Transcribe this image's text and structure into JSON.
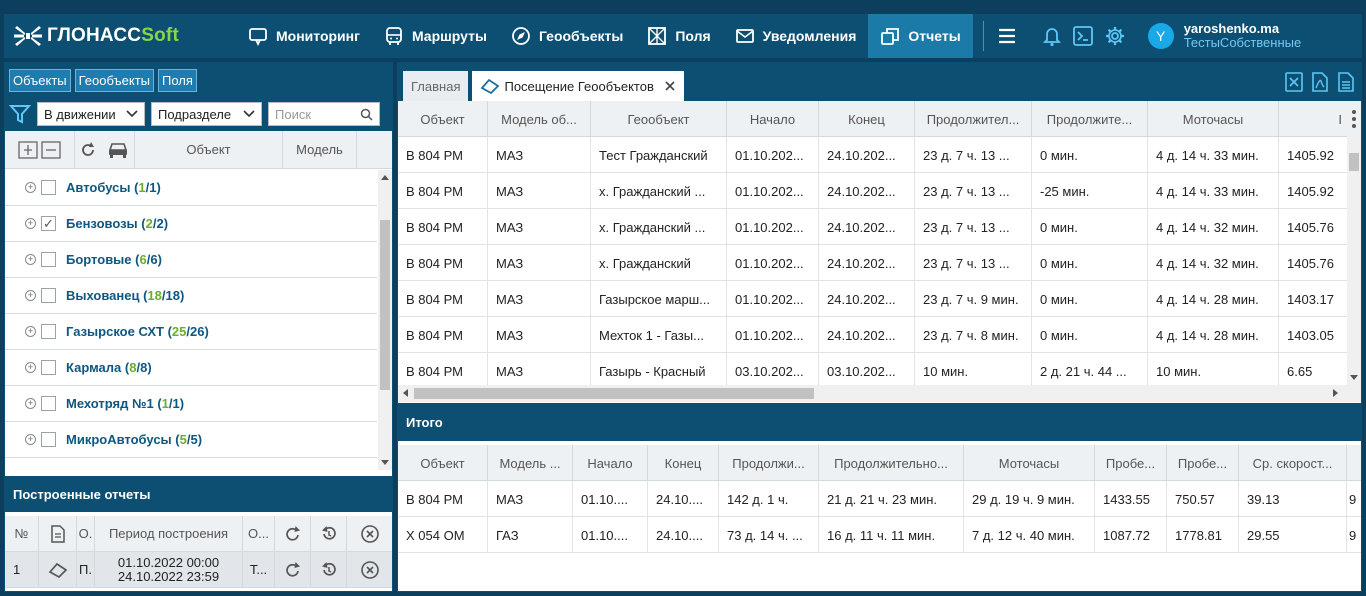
{
  "app": {
    "logo_main": "ГЛОНАСС",
    "logo_soft": "Soft"
  },
  "nav": [
    {
      "label": "Мониторинг",
      "icon": "monitor-icon"
    },
    {
      "label": "Маршруты",
      "icon": "bus-icon"
    },
    {
      "label": "Геообъекты",
      "icon": "compass-icon"
    },
    {
      "label": "Поля",
      "icon": "field-icon"
    },
    {
      "label": "Уведомления",
      "icon": "mail-icon"
    },
    {
      "label": "Отчеты",
      "icon": "reports-icon",
      "active": true
    }
  ],
  "user": {
    "initial": "Y",
    "name": "yaroshenko.ma",
    "org": "ТестыСобственные"
  },
  "left": {
    "tabs": [
      "Объекты",
      "Геообъекты",
      "Поля"
    ],
    "filter": {
      "motion": "В движении",
      "division": "Подразделе",
      "search_placeholder": "Поиск"
    },
    "columns": {
      "object": "Объект",
      "model": "Модель"
    },
    "groups": [
      {
        "name": "Автобусы",
        "on": "1",
        "total": "1",
        "checked": false
      },
      {
        "name": "Бензовозы",
        "on": "2",
        "total": "2",
        "checked": true
      },
      {
        "name": "Бортовые",
        "on": "6",
        "total": "6",
        "checked": false
      },
      {
        "name": "Выхованец",
        "on": "18",
        "total": "18",
        "checked": false
      },
      {
        "name": "Газырское СХТ",
        "on": "25",
        "total": "26",
        "checked": false
      },
      {
        "name": "Кармала",
        "on": "8",
        "total": "8",
        "checked": false
      },
      {
        "name": "Мехотряд №1",
        "on": "1",
        "total": "1",
        "checked": false
      },
      {
        "name": "МикроАвтобусы",
        "on": "5",
        "total": "5",
        "checked": false
      }
    ],
    "built_title": "Построенные отчеты",
    "built_cols": {
      "num": "№",
      "o1": "О.",
      "period": "Период построения",
      "o2": "О..."
    },
    "built_rows": [
      {
        "num": "1",
        "o1": "П.",
        "period_from": "01.10.2022 00:00",
        "period_to": "24.10.2022 23:59",
        "o2": "Т..."
      }
    ]
  },
  "right": {
    "tabs": {
      "home": "Главная",
      "report": "Посещение Геообъектов"
    },
    "grid_cols": [
      "Объект",
      "Модель об...",
      "Геообъект",
      "Начало",
      "Конец",
      "Продолжител...",
      "Продолжите...",
      "Моточасы",
      "I"
    ],
    "grid_rows": [
      [
        "В 804 РМ",
        "МАЗ",
        "Тест Гражданский",
        "01.10.202...",
        "24.10.202...",
        "23 д. 7 ч. 13 ...",
        "0 мин.",
        "4 д. 14 ч. 33 мин.",
        "1405.92"
      ],
      [
        "В 804 РМ",
        "МАЗ",
        "х. Гражданский ...",
        "01.10.202...",
        "24.10.202...",
        "23 д. 7 ч. 13 ...",
        "-25 мин.",
        "4 д. 14 ч. 33 мин.",
        "1405.92"
      ],
      [
        "В 804 РМ",
        "МАЗ",
        "х. Гражданский ...",
        "01.10.202...",
        "24.10.202...",
        "23 д. 7 ч. 13 ...",
        "0 мин.",
        "4 д. 14 ч. 32 мин.",
        "1405.76"
      ],
      [
        "В 804 РМ",
        "МАЗ",
        "х. Гражданский",
        "01.10.202...",
        "24.10.202...",
        "23 д. 7 ч. 13 ...",
        "0 мин.",
        "4 д. 14 ч. 32 мин.",
        "1405.76"
      ],
      [
        "В 804 РМ",
        "МАЗ",
        "Газырское марш...",
        "01.10.202...",
        "24.10.202...",
        "23 д. 7 ч. 9 мин.",
        "0 мин.",
        "4 д. 14 ч. 28 мин.",
        "1403.17"
      ],
      [
        "В 804 РМ",
        "МАЗ",
        "Мехток 1 - Газы...",
        "01.10.202...",
        "24.10.202...",
        "23 д. 7 ч. 8 мин.",
        "0 мин.",
        "4 д. 14 ч. 28 мин.",
        "1403.05"
      ],
      [
        "В 804 РМ",
        "МАЗ",
        "Газырь - Красный",
        "03.10.202...",
        "03.10.202...",
        "10 мин.",
        "2 д. 21 ч. 44 ...",
        "10 мин.",
        "6.65"
      ]
    ],
    "itogo_title": "Итого",
    "sum_cols": [
      "Объект",
      "Модель ...",
      "Начало",
      "Конец",
      "Продолжи...",
      "Продолжительно...",
      "Моточасы",
      "Пробе...",
      "Пробе...",
      "Ср. скорост...",
      ""
    ],
    "sum_rows": [
      [
        "В 804 РМ",
        "МАЗ",
        "01.10....",
        "24.10....",
        "142 д. 1 ч.",
        "21 д. 21 ч. 23 мин.",
        "29 д. 19 ч. 9 мин.",
        "1433.55",
        "750.57",
        "39.13",
        "9"
      ],
      [
        "Х 054 ОМ",
        "ГАЗ",
        "01.10....",
        "24.10....",
        "73 д. 14 ч. ...",
        "16 д. 11 ч. 11 мин.",
        "7 д. 12 ч. 40 мин.",
        "1087.72",
        "1778.81",
        "29.55",
        "9"
      ]
    ]
  }
}
